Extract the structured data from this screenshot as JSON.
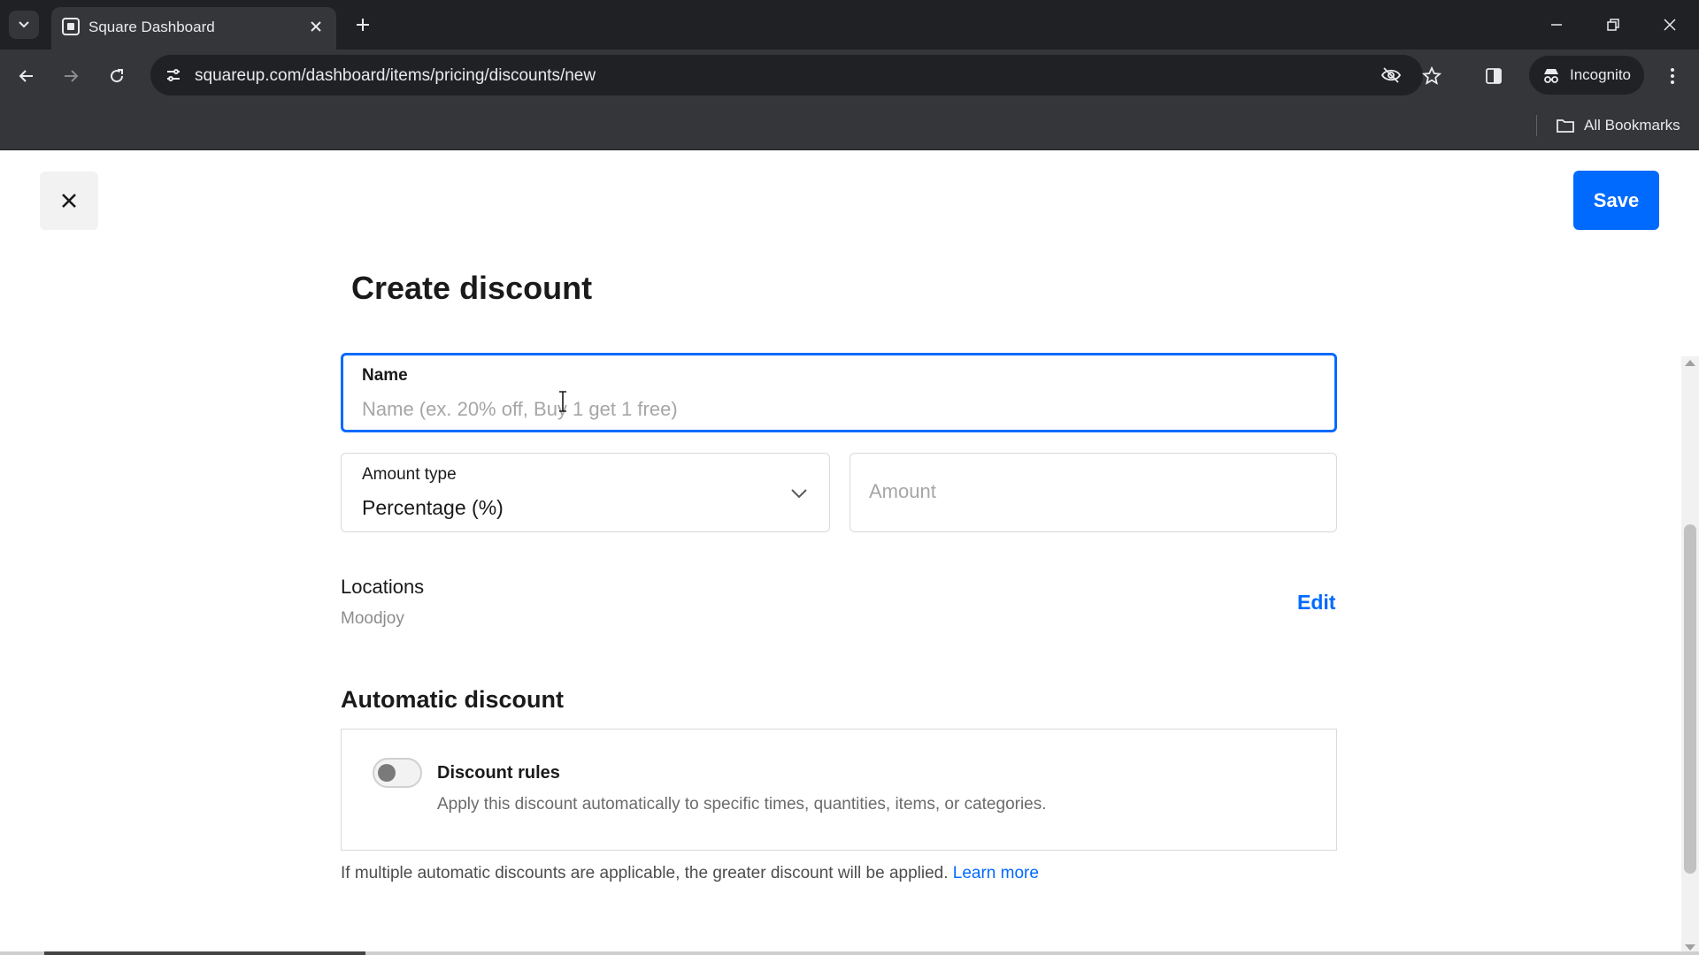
{
  "browser": {
    "tab_title": "Square Dashboard",
    "url": "squareup.com/dashboard/items/pricing/discounts/new",
    "incognito_label": "Incognito",
    "bookmarks_label": "All Bookmarks"
  },
  "header": {
    "save_label": "Save"
  },
  "page": {
    "title": "Create discount"
  },
  "form": {
    "name_label": "Name",
    "name_placeholder": "Name (ex. 20% off, Buy 1 get 1 free)",
    "amount_type_label": "Amount type",
    "amount_type_value": "Percentage (%)",
    "amount_placeholder": "Amount"
  },
  "locations": {
    "heading": "Locations",
    "value": "Moodjoy",
    "edit_label": "Edit"
  },
  "automatic": {
    "heading": "Automatic discount",
    "rule_title": "Discount rules",
    "rule_desc": "Apply this discount automatically to specific times, quantities, items, or categories.",
    "rule_enabled": false,
    "footnote": "If multiple automatic discounts are applicable, the greater discount will be applied.",
    "learn_more": "Learn more"
  },
  "colors": {
    "accent": "#006aff",
    "chrome_dark": "#202124",
    "chrome_mid": "#35363a"
  }
}
